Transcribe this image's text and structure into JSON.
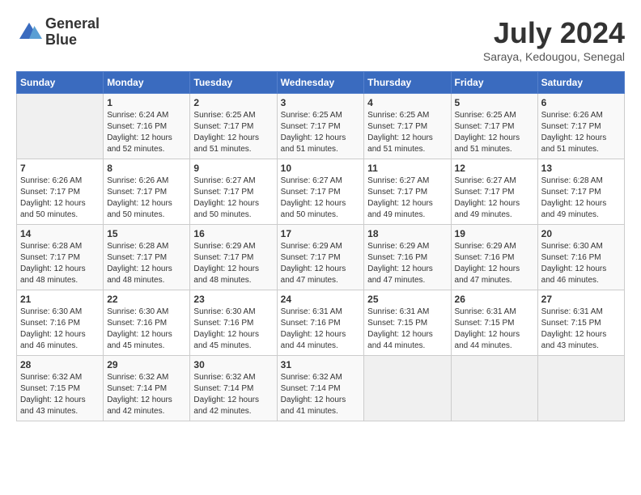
{
  "logo": {
    "line1": "General",
    "line2": "Blue"
  },
  "title": "July 2024",
  "subtitle": "Saraya, Kedougou, Senegal",
  "weekdays": [
    "Sunday",
    "Monday",
    "Tuesday",
    "Wednesday",
    "Thursday",
    "Friday",
    "Saturday"
  ],
  "weeks": [
    [
      {
        "day": "",
        "sunrise": "",
        "sunset": "",
        "daylight": ""
      },
      {
        "day": "1",
        "sunrise": "Sunrise: 6:24 AM",
        "sunset": "Sunset: 7:16 PM",
        "daylight": "Daylight: 12 hours and 52 minutes."
      },
      {
        "day": "2",
        "sunrise": "Sunrise: 6:25 AM",
        "sunset": "Sunset: 7:17 PM",
        "daylight": "Daylight: 12 hours and 51 minutes."
      },
      {
        "day": "3",
        "sunrise": "Sunrise: 6:25 AM",
        "sunset": "Sunset: 7:17 PM",
        "daylight": "Daylight: 12 hours and 51 minutes."
      },
      {
        "day": "4",
        "sunrise": "Sunrise: 6:25 AM",
        "sunset": "Sunset: 7:17 PM",
        "daylight": "Daylight: 12 hours and 51 minutes."
      },
      {
        "day": "5",
        "sunrise": "Sunrise: 6:25 AM",
        "sunset": "Sunset: 7:17 PM",
        "daylight": "Daylight: 12 hours and 51 minutes."
      },
      {
        "day": "6",
        "sunrise": "Sunrise: 6:26 AM",
        "sunset": "Sunset: 7:17 PM",
        "daylight": "Daylight: 12 hours and 51 minutes."
      }
    ],
    [
      {
        "day": "7",
        "sunrise": "Sunrise: 6:26 AM",
        "sunset": "Sunset: 7:17 PM",
        "daylight": "Daylight: 12 hours and 50 minutes."
      },
      {
        "day": "8",
        "sunrise": "Sunrise: 6:26 AM",
        "sunset": "Sunset: 7:17 PM",
        "daylight": "Daylight: 12 hours and 50 minutes."
      },
      {
        "day": "9",
        "sunrise": "Sunrise: 6:27 AM",
        "sunset": "Sunset: 7:17 PM",
        "daylight": "Daylight: 12 hours and 50 minutes."
      },
      {
        "day": "10",
        "sunrise": "Sunrise: 6:27 AM",
        "sunset": "Sunset: 7:17 PM",
        "daylight": "Daylight: 12 hours and 50 minutes."
      },
      {
        "day": "11",
        "sunrise": "Sunrise: 6:27 AM",
        "sunset": "Sunset: 7:17 PM",
        "daylight": "Daylight: 12 hours and 49 minutes."
      },
      {
        "day": "12",
        "sunrise": "Sunrise: 6:27 AM",
        "sunset": "Sunset: 7:17 PM",
        "daylight": "Daylight: 12 hours and 49 minutes."
      },
      {
        "day": "13",
        "sunrise": "Sunrise: 6:28 AM",
        "sunset": "Sunset: 7:17 PM",
        "daylight": "Daylight: 12 hours and 49 minutes."
      }
    ],
    [
      {
        "day": "14",
        "sunrise": "Sunrise: 6:28 AM",
        "sunset": "Sunset: 7:17 PM",
        "daylight": "Daylight: 12 hours and 48 minutes."
      },
      {
        "day": "15",
        "sunrise": "Sunrise: 6:28 AM",
        "sunset": "Sunset: 7:17 PM",
        "daylight": "Daylight: 12 hours and 48 minutes."
      },
      {
        "day": "16",
        "sunrise": "Sunrise: 6:29 AM",
        "sunset": "Sunset: 7:17 PM",
        "daylight": "Daylight: 12 hours and 48 minutes."
      },
      {
        "day": "17",
        "sunrise": "Sunrise: 6:29 AM",
        "sunset": "Sunset: 7:17 PM",
        "daylight": "Daylight: 12 hours and 47 minutes."
      },
      {
        "day": "18",
        "sunrise": "Sunrise: 6:29 AM",
        "sunset": "Sunset: 7:16 PM",
        "daylight": "Daylight: 12 hours and 47 minutes."
      },
      {
        "day": "19",
        "sunrise": "Sunrise: 6:29 AM",
        "sunset": "Sunset: 7:16 PM",
        "daylight": "Daylight: 12 hours and 47 minutes."
      },
      {
        "day": "20",
        "sunrise": "Sunrise: 6:30 AM",
        "sunset": "Sunset: 7:16 PM",
        "daylight": "Daylight: 12 hours and 46 minutes."
      }
    ],
    [
      {
        "day": "21",
        "sunrise": "Sunrise: 6:30 AM",
        "sunset": "Sunset: 7:16 PM",
        "daylight": "Daylight: 12 hours and 46 minutes."
      },
      {
        "day": "22",
        "sunrise": "Sunrise: 6:30 AM",
        "sunset": "Sunset: 7:16 PM",
        "daylight": "Daylight: 12 hours and 45 minutes."
      },
      {
        "day": "23",
        "sunrise": "Sunrise: 6:30 AM",
        "sunset": "Sunset: 7:16 PM",
        "daylight": "Daylight: 12 hours and 45 minutes."
      },
      {
        "day": "24",
        "sunrise": "Sunrise: 6:31 AM",
        "sunset": "Sunset: 7:16 PM",
        "daylight": "Daylight: 12 hours and 44 minutes."
      },
      {
        "day": "25",
        "sunrise": "Sunrise: 6:31 AM",
        "sunset": "Sunset: 7:15 PM",
        "daylight": "Daylight: 12 hours and 44 minutes."
      },
      {
        "day": "26",
        "sunrise": "Sunrise: 6:31 AM",
        "sunset": "Sunset: 7:15 PM",
        "daylight": "Daylight: 12 hours and 44 minutes."
      },
      {
        "day": "27",
        "sunrise": "Sunrise: 6:31 AM",
        "sunset": "Sunset: 7:15 PM",
        "daylight": "Daylight: 12 hours and 43 minutes."
      }
    ],
    [
      {
        "day": "28",
        "sunrise": "Sunrise: 6:32 AM",
        "sunset": "Sunset: 7:15 PM",
        "daylight": "Daylight: 12 hours and 43 minutes."
      },
      {
        "day": "29",
        "sunrise": "Sunrise: 6:32 AM",
        "sunset": "Sunset: 7:14 PM",
        "daylight": "Daylight: 12 hours and 42 minutes."
      },
      {
        "day": "30",
        "sunrise": "Sunrise: 6:32 AM",
        "sunset": "Sunset: 7:14 PM",
        "daylight": "Daylight: 12 hours and 42 minutes."
      },
      {
        "day": "31",
        "sunrise": "Sunrise: 6:32 AM",
        "sunset": "Sunset: 7:14 PM",
        "daylight": "Daylight: 12 hours and 41 minutes."
      },
      {
        "day": "",
        "sunrise": "",
        "sunset": "",
        "daylight": ""
      },
      {
        "day": "",
        "sunrise": "",
        "sunset": "",
        "daylight": ""
      },
      {
        "day": "",
        "sunrise": "",
        "sunset": "",
        "daylight": ""
      }
    ]
  ]
}
